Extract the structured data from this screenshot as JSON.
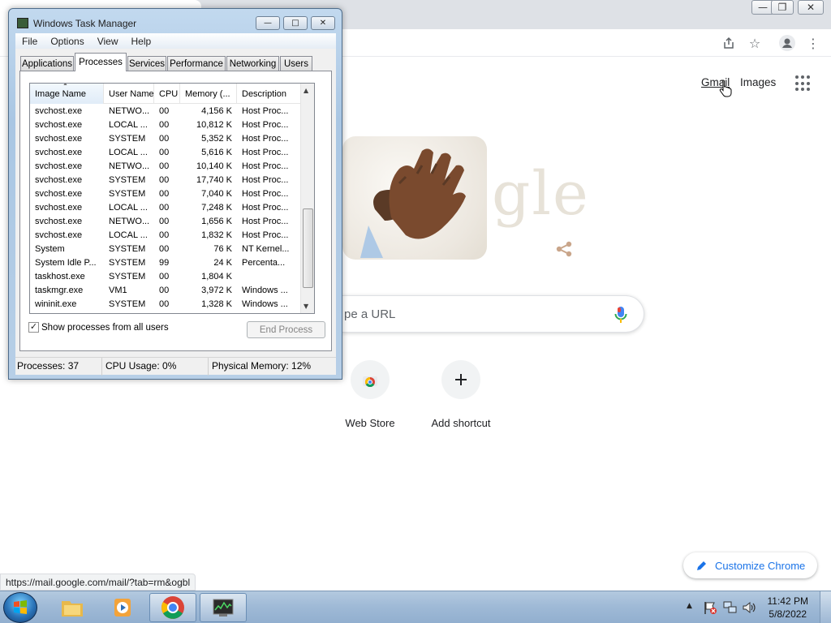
{
  "chrome": {
    "gmail": "Gmail",
    "images": "Images",
    "search_placeholder": "pe a URL",
    "doodle_letters": "gle",
    "shortcuts": [
      {
        "label": "Web Store"
      },
      {
        "label": "Add shortcut"
      }
    ],
    "customize": "Customize Chrome",
    "status_url": "https://mail.google.com/mail/?tab=rm&ogbl"
  },
  "taskmgr": {
    "title": "Windows Task Manager",
    "menu": [
      "File",
      "Options",
      "View",
      "Help"
    ],
    "tabs": [
      "Applications",
      "Processes",
      "Services",
      "Performance",
      "Networking",
      "Users"
    ],
    "active_tab": "Processes",
    "columns": [
      "Image Name",
      "User Name",
      "CPU",
      "Memory (...",
      "Description"
    ],
    "rows": [
      [
        "svchost.exe",
        "NETWO...",
        "00",
        "4,156 K",
        "Host Proc..."
      ],
      [
        "svchost.exe",
        "LOCAL ...",
        "00",
        "10,812 K",
        "Host Proc..."
      ],
      [
        "svchost.exe",
        "SYSTEM",
        "00",
        "5,352 K",
        "Host Proc..."
      ],
      [
        "svchost.exe",
        "LOCAL ...",
        "00",
        "5,616 K",
        "Host Proc..."
      ],
      [
        "svchost.exe",
        "NETWO...",
        "00",
        "10,140 K",
        "Host Proc..."
      ],
      [
        "svchost.exe",
        "SYSTEM",
        "00",
        "17,740 K",
        "Host Proc..."
      ],
      [
        "svchost.exe",
        "SYSTEM",
        "00",
        "7,040 K",
        "Host Proc..."
      ],
      [
        "svchost.exe",
        "LOCAL ...",
        "00",
        "7,248 K",
        "Host Proc..."
      ],
      [
        "svchost.exe",
        "NETWO...",
        "00",
        "1,656 K",
        "Host Proc..."
      ],
      [
        "svchost.exe",
        "LOCAL ...",
        "00",
        "1,832 K",
        "Host Proc..."
      ],
      [
        "System",
        "SYSTEM",
        "00",
        "76 K",
        "NT Kernel..."
      ],
      [
        "System Idle P...",
        "SYSTEM",
        "99",
        "24 K",
        "Percenta..."
      ],
      [
        "taskhost.exe",
        "SYSTEM",
        "00",
        "1,804 K",
        ""
      ],
      [
        "taskmgr.exe",
        "VM1",
        "00",
        "3,972 K",
        "Windows ..."
      ],
      [
        "wininit.exe",
        "SYSTEM",
        "00",
        "1,328 K",
        "Windows ..."
      ]
    ],
    "show_all_label": "Show processes from all users",
    "show_all_checked": true,
    "end_process": "End Process",
    "status": {
      "processes": "Processes: 37",
      "cpu": "CPU Usage: 0%",
      "memory": "Physical Memory: 12%"
    }
  },
  "taskbar": {
    "time": "11:42 PM",
    "date": "5/8/2022"
  },
  "colors": {
    "accent_blue": "#1a73e8",
    "taskbar": "#9eb9d6"
  }
}
